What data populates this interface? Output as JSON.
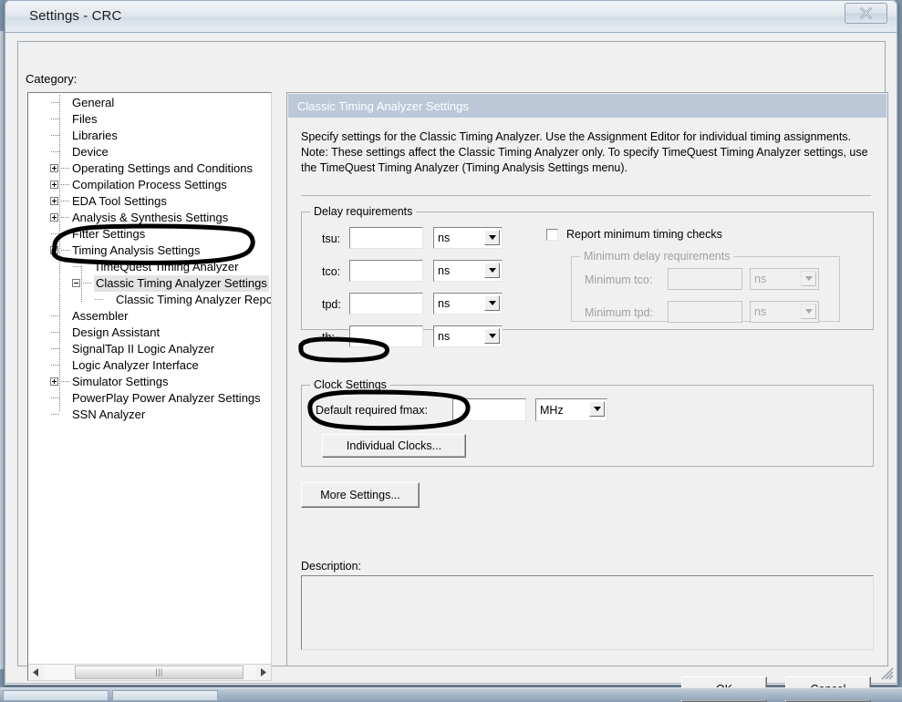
{
  "window": {
    "title": "Settings - CRC",
    "close_icon": "close-x-icon"
  },
  "category": {
    "label": "Category:",
    "tree": [
      {
        "label": "General",
        "indent": 0,
        "toggle": "none"
      },
      {
        "label": "Files",
        "indent": 0,
        "toggle": "none"
      },
      {
        "label": "Libraries",
        "indent": 0,
        "toggle": "none"
      },
      {
        "label": "Device",
        "indent": 0,
        "toggle": "none"
      },
      {
        "label": "Operating Settings and Conditions",
        "indent": 0,
        "toggle": "plus"
      },
      {
        "label": "Compilation Process Settings",
        "indent": 0,
        "toggle": "plus"
      },
      {
        "label": "EDA Tool Settings",
        "indent": 0,
        "toggle": "plus"
      },
      {
        "label": "Analysis & Synthesis Settings",
        "indent": 0,
        "toggle": "plus"
      },
      {
        "label": "Fitter Settings",
        "indent": 0,
        "toggle": "none"
      },
      {
        "label": "Timing Analysis Settings",
        "indent": 0,
        "toggle": "minus"
      },
      {
        "label": "TimeQuest Timing Analyzer",
        "indent": 1,
        "toggle": "none"
      },
      {
        "label": "Classic Timing Analyzer Settings",
        "indent": 1,
        "toggle": "minus",
        "selected": true
      },
      {
        "label": "Classic Timing Analyzer Reporting",
        "indent": 2,
        "toggle": "none"
      },
      {
        "label": "Assembler",
        "indent": 0,
        "toggle": "none"
      },
      {
        "label": "Design Assistant",
        "indent": 0,
        "toggle": "none"
      },
      {
        "label": "SignalTap II Logic Analyzer",
        "indent": 0,
        "toggle": "none"
      },
      {
        "label": "Logic Analyzer Interface",
        "indent": 0,
        "toggle": "none"
      },
      {
        "label": "Simulator Settings",
        "indent": 0,
        "toggle": "plus"
      },
      {
        "label": "PowerPlay Power Analyzer Settings",
        "indent": 0,
        "toggle": "none"
      },
      {
        "label": "SSN Analyzer",
        "indent": 0,
        "toggle": "none"
      }
    ],
    "scrollbar": {
      "left_arrow_icon": "arrow-left-icon",
      "right_arrow_icon": "arrow-right-icon",
      "thumb_grip": "|||"
    }
  },
  "panel": {
    "header": "Classic Timing Analyzer Settings",
    "description": "Specify settings for the Classic Timing Analyzer. Use the Assignment Editor for individual timing assignments. Note: These settings affect the Classic Timing Analyzer only. To specify TimeQuest Timing Analyzer settings, use the TimeQuest Timing Analyzer (Timing Analysis Settings menu).",
    "delay_group": {
      "title": "Delay requirements",
      "rows": [
        {
          "label": "tsu:",
          "value": "",
          "unit": "ns"
        },
        {
          "label": "tco:",
          "value": "",
          "unit": "ns"
        },
        {
          "label": "tpd:",
          "value": "",
          "unit": "ns"
        },
        {
          "label": "th:",
          "value": "",
          "unit": "ns"
        }
      ],
      "report_min_checks": {
        "label": "Report minimum timing checks",
        "checked": false
      },
      "minimum_group": {
        "title": "Minimum delay requirements",
        "enabled": false,
        "rows": [
          {
            "label": "Minimum tco:",
            "value": "",
            "unit": "ns"
          },
          {
            "label": "Minimum tpd:",
            "value": "",
            "unit": "ns"
          }
        ]
      }
    },
    "clock_group": {
      "title": "Clock Settings",
      "fmax_label": "Default required fmax:",
      "fmax_value": "",
      "fmax_unit": "MHz",
      "individual_clocks_button": "Individual Clocks..."
    },
    "more_settings_button": "More Settings...",
    "description_label": "Description:",
    "description_value": "",
    "desc_scrollbar": {
      "up_arrow_icon": "arrow-up-icon",
      "down_arrow_icon": "arrow-down-icon"
    }
  },
  "dialog_buttons": {
    "ok": "OK",
    "cancel": "Cancel"
  },
  "annotations": {
    "ink_color": "#000000",
    "circled": [
      "Classic Timing Analyzer Settings",
      "Clock Settings",
      "Individual Clocks..."
    ]
  },
  "colors": {
    "panel_header_bg": "#bcc8d8",
    "panel_header_text": "#ffffff",
    "dialog_bg": "#f0f0f0",
    "tree_bg": "#ffffff",
    "selection_bg": "#e4e4e4",
    "disabled_text": "#a0a0a0"
  }
}
